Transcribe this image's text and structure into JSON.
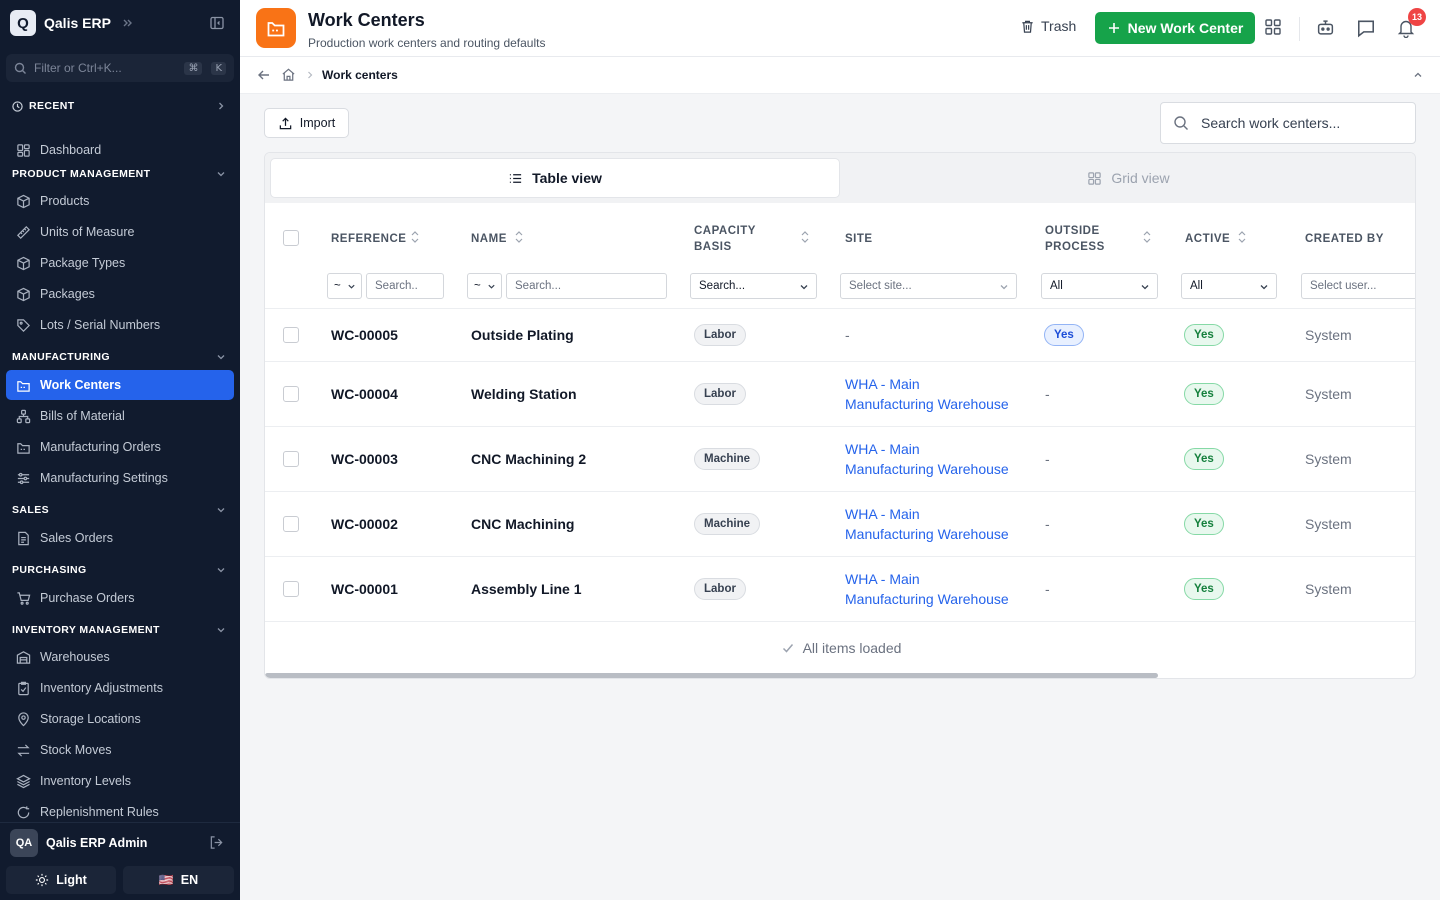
{
  "app": {
    "logo_letter": "Q",
    "name": "Qalis ERP",
    "filter_placeholder": "Filter or Ctrl+K...",
    "kbd_cmd": "⌘",
    "kbd_key": "K"
  },
  "sidebar": {
    "recent": "RECENT",
    "dashboard": "Dashboard",
    "sections": {
      "product": {
        "title": "PRODUCT MANAGEMENT",
        "items": [
          "Products",
          "Units of Measure",
          "Package Types",
          "Packages",
          "Lots / Serial Numbers"
        ]
      },
      "manufacturing": {
        "title": "MANUFACTURING",
        "items": [
          "Work Centers",
          "Bills of Material",
          "Manufacturing Orders",
          "Manufacturing Settings"
        ]
      },
      "sales": {
        "title": "SALES",
        "items": [
          "Sales Orders"
        ]
      },
      "purchasing": {
        "title": "PURCHASING",
        "items": [
          "Purchase Orders"
        ]
      },
      "inventory": {
        "title": "INVENTORY MANAGEMENT",
        "items": [
          "Warehouses",
          "Inventory Adjustments",
          "Storage Locations",
          "Stock Moves",
          "Inventory Levels",
          "Replenishment Rules"
        ]
      }
    },
    "active_item": "Work Centers",
    "user": {
      "initials": "QA",
      "name": "Qalis ERP Admin"
    },
    "theme_label": "Light",
    "lang_flag": "🇺🇸",
    "lang_label": "EN"
  },
  "header": {
    "title": "Work Centers",
    "subtitle": "Production work centers and routing defaults",
    "trash_label": "Trash",
    "new_label": "New Work Center",
    "notification_count": "13"
  },
  "breadcrumb": {
    "current": "Work centers"
  },
  "toolbar": {
    "import_label": "Import",
    "search_placeholder": "Search work centers..."
  },
  "views": {
    "table": "Table view",
    "grid": "Grid view"
  },
  "table": {
    "columns": {
      "reference": "REFERENCE",
      "name": "NAME",
      "capacity": "CAPACITY\nBASIS",
      "site": "SITE",
      "outside": "OUTSIDE\nPROCESS",
      "active": "ACTIVE",
      "created": "CREATED BY"
    },
    "filters": {
      "ref_op": "~",
      "ref_ph": "Search..",
      "name_op": "~",
      "name_ph": "Search...",
      "capacity_ph": "Search...",
      "site_ph": "Select site...",
      "outside_val": "All",
      "active_val": "All",
      "created_ph": "Select user..."
    },
    "rows": [
      {
        "ref": "WC-00005",
        "name": "Outside Plating",
        "capacity": "Labor",
        "site_line1": "-",
        "site_line2": "",
        "outside": "Yes",
        "active": "Yes",
        "created": "System"
      },
      {
        "ref": "WC-00004",
        "name": "Welding Station",
        "capacity": "Labor",
        "site_line1": "WHA - Main",
        "site_line2": "Manufacturing Warehouse",
        "outside": "-",
        "active": "Yes",
        "created": "System"
      },
      {
        "ref": "WC-00003",
        "name": "CNC Machining 2",
        "capacity": "Machine",
        "site_line1": "WHA - Main",
        "site_line2": "Manufacturing Warehouse",
        "outside": "-",
        "active": "Yes",
        "created": "System"
      },
      {
        "ref": "WC-00002",
        "name": "CNC Machining",
        "capacity": "Machine",
        "site_line1": "WHA - Main",
        "site_line2": "Manufacturing Warehouse",
        "outside": "-",
        "active": "Yes",
        "created": "System"
      },
      {
        "ref": "WC-00001",
        "name": "Assembly Line 1",
        "capacity": "Labor",
        "site_line1": "WHA - Main",
        "site_line2": "Manufacturing Warehouse",
        "outside": "-",
        "active": "Yes",
        "created": "System"
      }
    ],
    "footer": "All items loaded"
  },
  "colors": {
    "sidebar_bg": "#111b2e",
    "accent": "#2563eb",
    "primary_button": "#16a34a",
    "page_icon": "#f97316",
    "badge": "#ef4444"
  }
}
